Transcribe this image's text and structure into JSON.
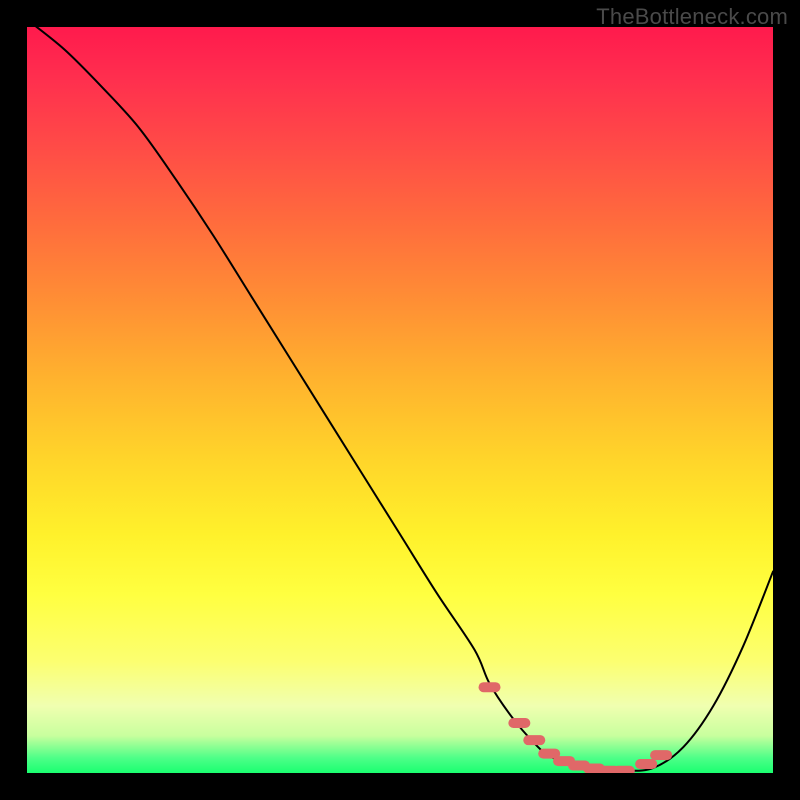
{
  "watermark_text": "TheBottleneck.com",
  "chart_data": {
    "type": "line",
    "title": "",
    "xlabel": "",
    "ylabel": "",
    "xlim": [
      0,
      100
    ],
    "ylim": [
      0,
      100
    ],
    "grid": false,
    "series": [
      {
        "name": "bottleneck-curve",
        "x": [
          0,
          5,
          10,
          15,
          20,
          25,
          30,
          35,
          40,
          45,
          50,
          55,
          60,
          62,
          65,
          68,
          70,
          73,
          76,
          80,
          84,
          88,
          92,
          96,
          100
        ],
        "y": [
          101,
          97,
          92,
          86.5,
          79.5,
          72,
          64,
          56,
          48,
          40,
          32,
          24,
          16.5,
          12,
          7.5,
          4,
          2.3,
          1.1,
          0.5,
          0.3,
          0.7,
          3.5,
          9,
          17,
          27
        ]
      }
    ],
    "highlight_region": {
      "name": "optimal-zone-dots",
      "x": [
        62,
        66,
        68,
        70,
        72,
        74,
        76,
        78,
        80,
        83,
        85
      ],
      "y": [
        11.5,
        6.7,
        4.4,
        2.6,
        1.6,
        1.0,
        0.6,
        0.3,
        0.3,
        1.2,
        2.4
      ],
      "color": "#e06868"
    },
    "background_gradient": {
      "direction": "vertical",
      "stops": [
        {
          "pos": 0.0,
          "color": "#ff1a4d"
        },
        {
          "pos": 0.36,
          "color": "#ff8c35"
        },
        {
          "pos": 0.68,
          "color": "#fff12b"
        },
        {
          "pos": 0.95,
          "color": "#c8ff9e"
        },
        {
          "pos": 1.0,
          "color": "#1aff70"
        }
      ]
    }
  }
}
